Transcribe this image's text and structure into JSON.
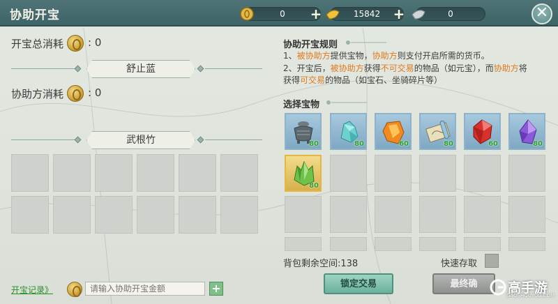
{
  "title": "协助开宝",
  "currencies": [
    {
      "icon": "gold-coin-icon",
      "value": "0"
    },
    {
      "icon": "gold-ingot-icon",
      "value": "15842"
    },
    {
      "icon": "silver-ingot-icon",
      "value": "0"
    }
  ],
  "left": {
    "total_cost_label": "开宝总消耗",
    "total_cost_value": ": 0",
    "owner_name": "舒止蓝",
    "helper_cost_label": "协助方消耗",
    "helper_cost_value": ": 0",
    "helper_name": "武根竹"
  },
  "rules": {
    "title": "协助开宝规则",
    "line1_prefix": "1、",
    "line1_a": "被协助方",
    "line1_b": "提供宝物，",
    "line1_c": "协助方",
    "line1_d": "则支付开启所需的货币。",
    "line2_prefix": "2、开宝后，",
    "line2_a": "被协助方",
    "line2_b": "获得",
    "line2_c": "不可交易",
    "line2_d": "的物品（如元宝），而",
    "line2_e": "协助方",
    "line2_f": "将",
    "line3_a": "获得",
    "line3_b": "可交易",
    "line3_c": "的物品（如宝石、坐骑碎片等）"
  },
  "select_title": "选择宝物",
  "items": [
    {
      "name": "treasure-censer",
      "count": "80"
    },
    {
      "name": "treasure-cyan-crystal",
      "count": "80"
    },
    {
      "name": "treasure-orange-gem",
      "count": "60"
    },
    {
      "name": "treasure-scroll",
      "count": "80"
    },
    {
      "name": "treasure-red-crystal",
      "count": "60"
    },
    {
      "name": "treasure-purple-crystal",
      "count": "80"
    },
    {
      "name": "treasure-green-crystal",
      "count": "80"
    }
  ],
  "bag_space": "背包剩余空间:138",
  "quick_store": "快速存取",
  "lock_trade": "锁定交易",
  "final_confirm": "最终确",
  "record_link": "开宝记录》",
  "amount_placeholder": "请输入协助开宝金额",
  "watermark": "高手游",
  "watermark_sub": "GAOSHOUYOU.COM",
  "colors": {
    "highlight": "#e07a1e",
    "titlebar": "#4e7477",
    "count": "#2ea02e"
  }
}
